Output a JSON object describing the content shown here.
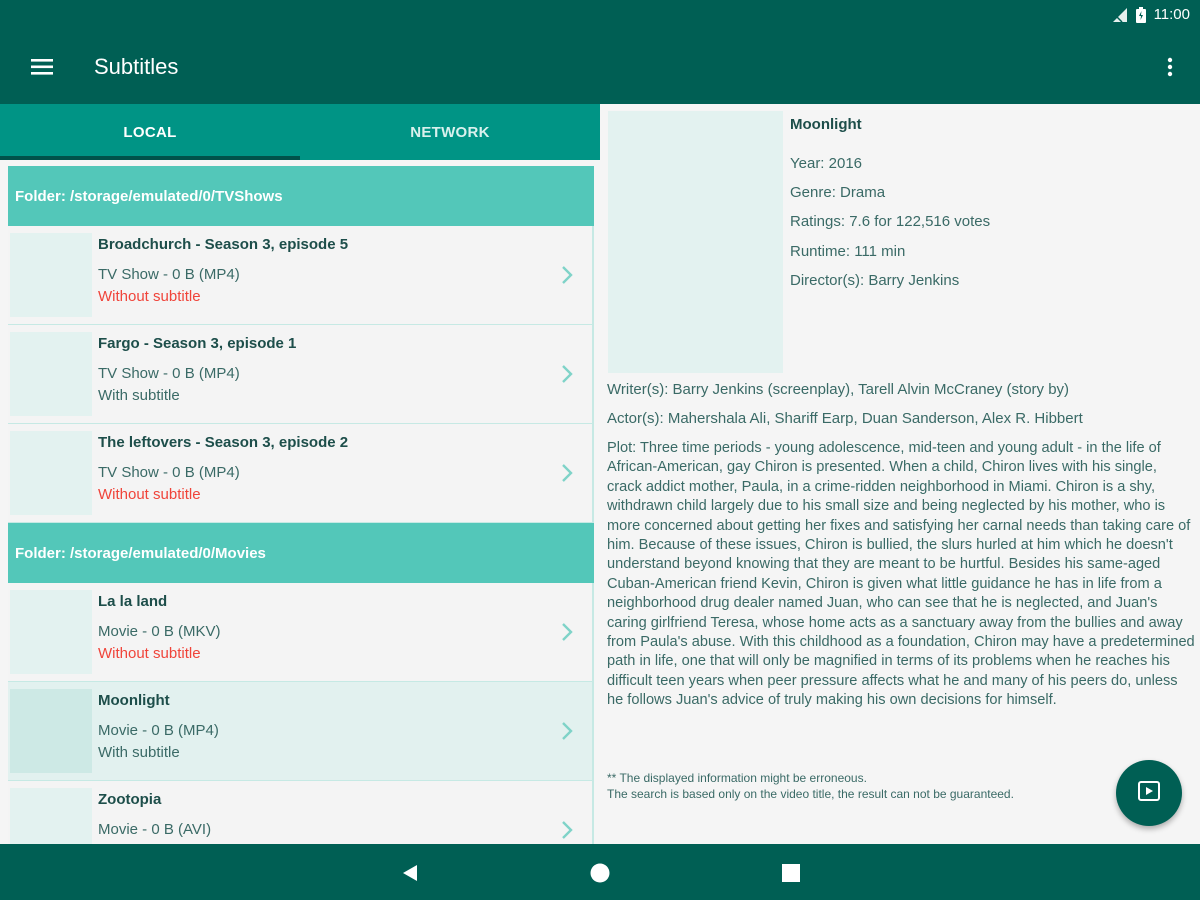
{
  "status_bar": {
    "time": "11:00",
    "icons": [
      "signal-icon",
      "battery-icon"
    ]
  },
  "app_bar": {
    "title": "Subtitles",
    "menu_icon": "menu-icon",
    "overflow_icon": "more-vert-icon"
  },
  "tabs": [
    {
      "label": "LOCAL",
      "selected": true
    },
    {
      "label": "NETWORK",
      "selected": false
    }
  ],
  "folders": [
    {
      "label": "Folder: /storage/emulated/0/TVShows",
      "items": [
        {
          "title": "Broadchurch - Season 3, episode 5",
          "meta": "TV Show - 0 B (MP4)",
          "subtitle": "Without subtitle",
          "has_subtitle": false
        },
        {
          "title": "Fargo - Season 3, episode 1",
          "meta": "TV Show - 0 B (MP4)",
          "subtitle": "With subtitle",
          "has_subtitle": true
        },
        {
          "title": "The leftovers - Season 3, episode 2",
          "meta": "TV Show - 0 B (MP4)",
          "subtitle": "Without subtitle",
          "has_subtitle": false
        }
      ]
    },
    {
      "label": "Folder: /storage/emulated/0/Movies",
      "items": [
        {
          "title": "La la land",
          "meta": "Movie - 0 B (MKV)",
          "subtitle": "Without subtitle",
          "has_subtitle": false
        },
        {
          "title": "Moonlight",
          "meta": "Movie - 0 B (MP4)",
          "subtitle": "With subtitle",
          "has_subtitle": true,
          "selected": true
        },
        {
          "title": "Zootopia",
          "meta": "Movie - 0 B (AVI)",
          "subtitle": "",
          "has_subtitle": false
        }
      ]
    }
  ],
  "detail": {
    "title": "Moonlight",
    "year": "Year: 2016",
    "genre": "Genre: Drama",
    "ratings": "Ratings: 7.6 for 122,516 votes",
    "runtime": "Runtime: 111 min",
    "directors": "Director(s): Barry Jenkins",
    "writers": "Writer(s): Barry Jenkins (screenplay), Tarell Alvin McCraney (story by)",
    "actors": "Actor(s): Mahershala Ali, Shariff Earp, Duan Sanderson, Alex R. Hibbert",
    "plot": "Plot: Three time periods - young adolescence, mid-teen and young adult - in the life of African-American, gay Chiron is presented. When a child, Chiron lives with his single, crack addict mother, Paula, in a crime-ridden neighborhood in Miami. Chiron is a shy, withdrawn child largely due to his small size and being neglected by his mother, who is more concerned about getting her fixes and satisfying her carnal needs than taking care of him. Because of these issues, Chiron is bullied, the slurs hurled at him which he doesn't understand beyond knowing that they are meant to be hurtful. Besides his same-aged Cuban-American friend Kevin, Chiron is given what little guidance he has in life from a neighborhood drug dealer named Juan, who can see that he is neglected, and Juan's caring girlfriend Teresa, whose home acts as a sanctuary away from the bullies and away from Paula's abuse. With this childhood as a foundation, Chiron may have a predetermined path in life, one that will only be magnified in terms of its problems when he reaches his difficult teen years when peer pressure affects what he and many of his peers do, unless he follows Juan's advice of truly making his own decisions for himself.",
    "disclaimer_1": "** The displayed information might be erroneous.",
    "disclaimer_2": "The search is based only on the video title, the result can not be guaranteed."
  },
  "fab": {
    "icon": "play-video-icon"
  },
  "nav_bar": {
    "icons": [
      "back-icon",
      "home-icon",
      "recents-icon"
    ]
  },
  "colors": {
    "primary_dark": "#005f54",
    "primary": "#009485",
    "folder_header": "#53c7b9",
    "missing_subtitle": "#f0443a"
  }
}
